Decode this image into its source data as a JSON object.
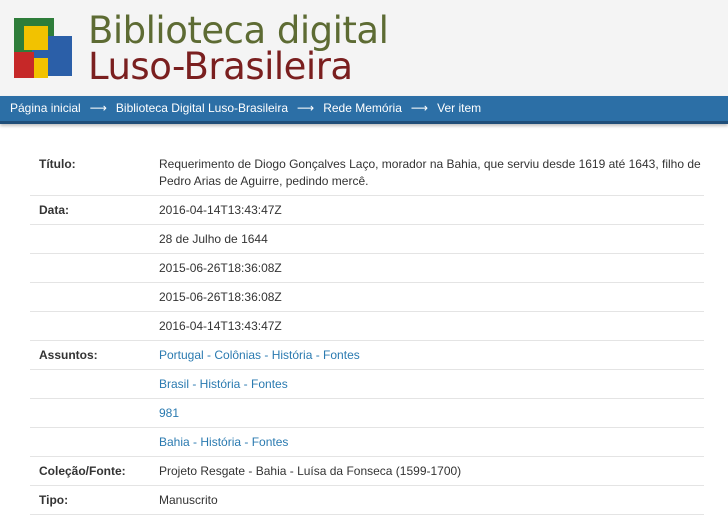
{
  "logo": {
    "line1": "Biblioteca digital",
    "line2": "Luso-Brasileira",
    "colors": [
      "#2e7d3a",
      "#2b5fa8",
      "#f2c200",
      "#c62828"
    ]
  },
  "breadcrumb": {
    "items": [
      {
        "label": "Página inicial"
      },
      {
        "label": "Biblioteca Digital Luso-Brasileira"
      },
      {
        "label": "Rede Memória"
      },
      {
        "label": "Ver item"
      }
    ],
    "separator": "⟶"
  },
  "metadata": {
    "titulo": {
      "label": "Título:",
      "value": "Requerimento de Diogo Gonçalves Laço, morador na Bahia, que serviu desde 1619 até 1643, filho de Pedro Arias de Aguirre, pedindo mercê."
    },
    "data": {
      "label": "Data:",
      "values": [
        "2016-04-14T13:43:47Z",
        "28 de Julho de 1644",
        "2015-06-26T18:36:08Z",
        "2015-06-26T18:36:08Z",
        "2016-04-14T13:43:47Z"
      ]
    },
    "assuntos": {
      "label": "Assuntos:",
      "values": [
        "Portugal - Colônias - História - Fontes",
        "Brasil - História - Fontes",
        "981",
        "Bahia - História - Fontes"
      ]
    },
    "colecao": {
      "label": "Coleção/Fonte:",
      "value": "Projeto Resgate - Bahia - Luísa da Fonseca (1599-1700)"
    },
    "tipo": {
      "label": "Tipo:",
      "value": "Manuscrito"
    }
  }
}
